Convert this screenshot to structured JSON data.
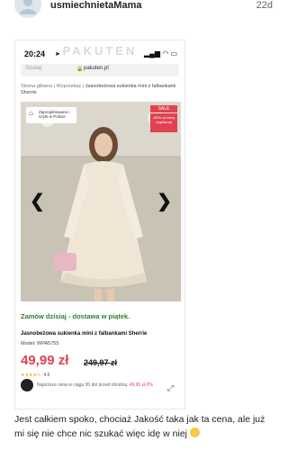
{
  "post": {
    "username": "usmiechnietaMama",
    "age": "22d",
    "text": "Jest całkiem spoko, chociaż Jakość taka jak ta cena, ale już mi się nie chce nic szukać więc idę w niej"
  },
  "phone": {
    "watermark": "PAKUTEN",
    "time": "20:24",
    "search_placeholder": "Szukaj",
    "url": "pakuten.pl"
  },
  "shop": {
    "breadcrumb": [
      "Strona główna",
      "Wyprzedaż",
      "Jasnobeżowa sukienka mini z falbankami Sherrie"
    ],
    "badge_made_in_poland": "Zaprojektowane i szyte w Polsce",
    "sale_label": "SALE",
    "sale_note": "-80% od ceny regularnej",
    "order_today": "Zamów dzisiaj - dostawa w piątek.",
    "product_title": "Jasnobeżowa sukienka mini z falbankami Sherrie",
    "model": "Model: WPA5755",
    "price": "49,99 zł",
    "old_price": "249,97 zł",
    "rating_stars": "★★★★½",
    "rating_value": "4.6",
    "lowest_price_label": "Najniższa cena w ciągu 30 dni przed obniżką:",
    "lowest_price_value": "49,99 zł",
    "lowest_price_pct": "0%"
  }
}
